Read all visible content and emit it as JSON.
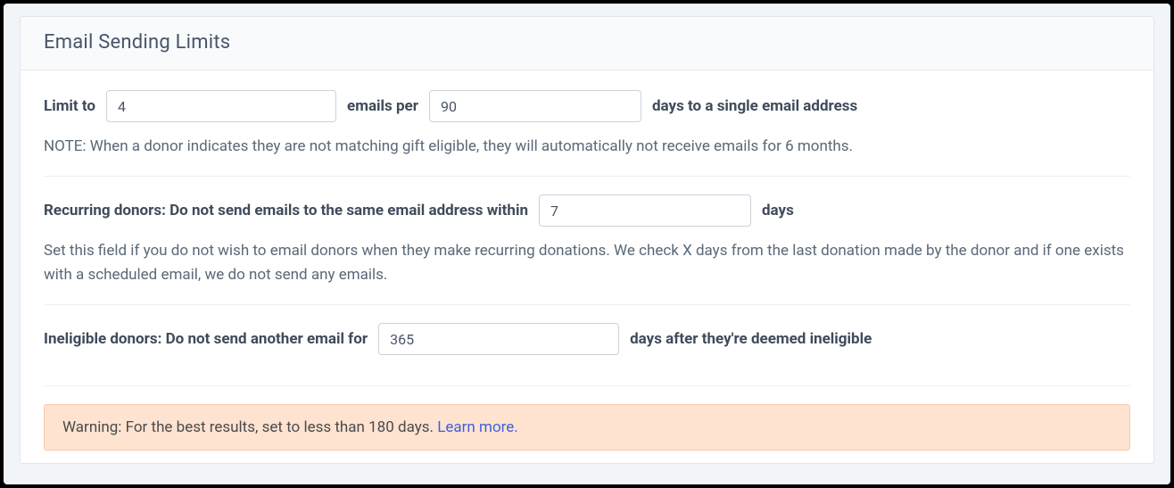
{
  "panel": {
    "title": "Email Sending Limits"
  },
  "limit": {
    "label_limit_to": "Limit to",
    "emails_count": "4",
    "label_emails_per": "emails per",
    "days_count": "90",
    "label_days_suffix": "days to a single email address",
    "note": "NOTE: When a donor indicates they are not matching gift eligible, they will automatically not receive emails for 6 months."
  },
  "recurring": {
    "label_prefix": "Recurring donors: Do not send emails to the same email address within",
    "days_value": "7",
    "label_suffix": "days",
    "help": "Set this field if you do not wish to email donors when they make recurring donations. We check X days from the last donation made by the donor and if one exists with a scheduled email, we do not send any emails."
  },
  "ineligible": {
    "label_prefix": "Ineligible donors: Do not send another email for",
    "days_value": "365",
    "label_suffix": "days after they're deemed ineligible"
  },
  "warning": {
    "text": "Warning: For the best results, set to less than 180 days. ",
    "link_text": "Learn more."
  }
}
